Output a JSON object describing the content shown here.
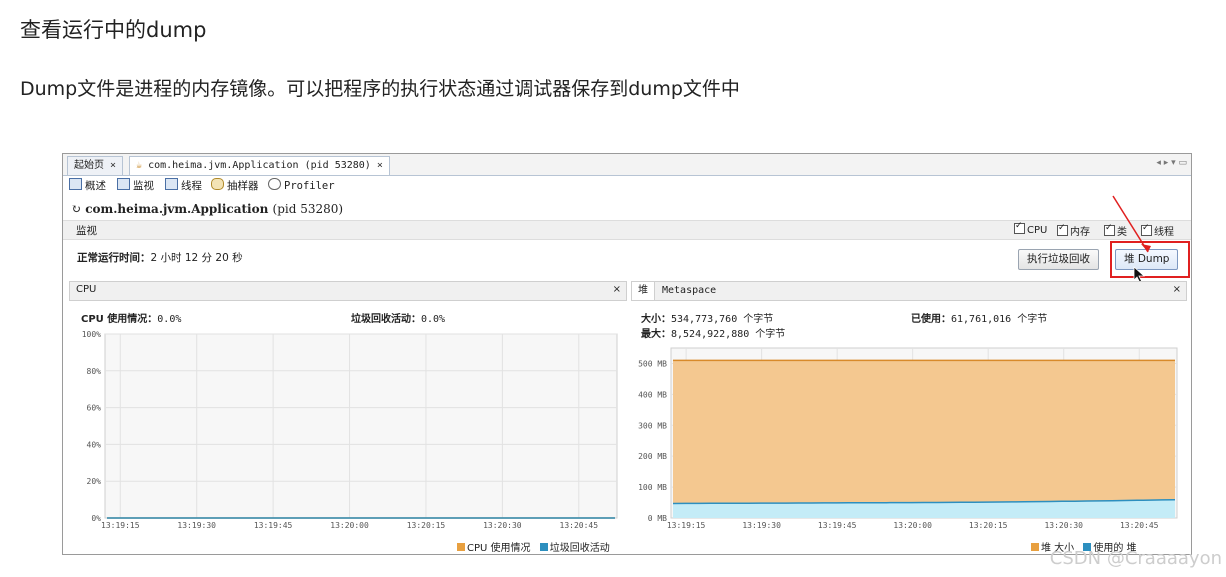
{
  "doc": {
    "title": "查看运行中的dump",
    "paragraph": "Dump文件是进程的内存镜像。可以把程序的执行状态通过调试器保存到dump文件中"
  },
  "tabs": [
    {
      "label": "起始页",
      "close": "×"
    },
    {
      "label": "com.heima.jvm.Application (pid 53280)",
      "close": "×"
    }
  ],
  "window_controls": "◂ ▸ ▾ ▭",
  "toolbar": {
    "overview": "概述",
    "monitor": "监视",
    "threads": "线程",
    "sampler": "抽样器",
    "profiler": "Profiler"
  },
  "app": {
    "name": "com.heima.jvm.Application",
    "pid": "(pid 53280)"
  },
  "monitor": {
    "label": "监视",
    "checks": [
      "CPU",
      "内存",
      "类",
      "线程"
    ]
  },
  "uptime": {
    "label": "正常运行时间：",
    "value": "2 小时 12 分 20 秒"
  },
  "buttons": {
    "gc": "执行垃圾回收",
    "heap_dump": "堆 Dump"
  },
  "cpu_panel": {
    "title": "CPU",
    "close": "×",
    "usage_label": "CPU 使用情况：",
    "usage_value": "0.0%",
    "gc_label": "垃圾回收活动：",
    "gc_value": "0.0%",
    "legend": [
      {
        "label": "CPU 使用情况",
        "color": "#e8a040"
      },
      {
        "label": "垃圾回收活动",
        "color": "#2d8fbf"
      }
    ]
  },
  "heap_panel": {
    "tabs": [
      "堆",
      "Metaspace"
    ],
    "close": "×",
    "size_label": "大小：",
    "size_value": "534,773,760 个字节",
    "max_label": "最大：",
    "max_value": "8,524,922,880 个字节",
    "used_label": "已使用：",
    "used_value": "61,761,016 个字节",
    "legend": [
      {
        "label": "堆 大小",
        "color": "#e8a040"
      },
      {
        "label": "使用的 堆",
        "color": "#2d8fbf"
      }
    ]
  },
  "watermark": "CSDN @Craaaayon",
  "chart_data": [
    {
      "type": "line",
      "title": "CPU",
      "x": [
        "13:19:15",
        "13:19:30",
        "13:19:45",
        "13:20:00",
        "13:20:15",
        "13:20:30",
        "13:20:45"
      ],
      "ylim": [
        0,
        100
      ],
      "yticks": [
        "0%",
        "20%",
        "40%",
        "60%",
        "80%",
        "100%"
      ],
      "series": [
        {
          "name": "CPU 使用情况",
          "values": [
            0,
            0,
            0,
            0,
            0,
            0,
            0
          ]
        },
        {
          "name": "垃圾回收活动",
          "values": [
            0,
            0,
            0,
            0,
            0,
            0,
            0
          ]
        }
      ]
    },
    {
      "type": "area",
      "title": "堆",
      "x": [
        "13:19:15",
        "13:19:30",
        "13:19:45",
        "13:20:00",
        "13:20:15",
        "13:20:30",
        "13:20:45"
      ],
      "ylim": [
        0,
        550
      ],
      "yticks": [
        "0 MB",
        "100 MB",
        "200 MB",
        "300 MB",
        "400 MB",
        "500 MB"
      ],
      "series": [
        {
          "name": "堆 大小",
          "values": [
            510,
            510,
            510,
            510,
            510,
            510,
            510
          ]
        },
        {
          "name": "使用的 堆",
          "values": [
            47,
            48,
            49,
            50,
            52,
            55,
            59
          ]
        }
      ]
    }
  ]
}
